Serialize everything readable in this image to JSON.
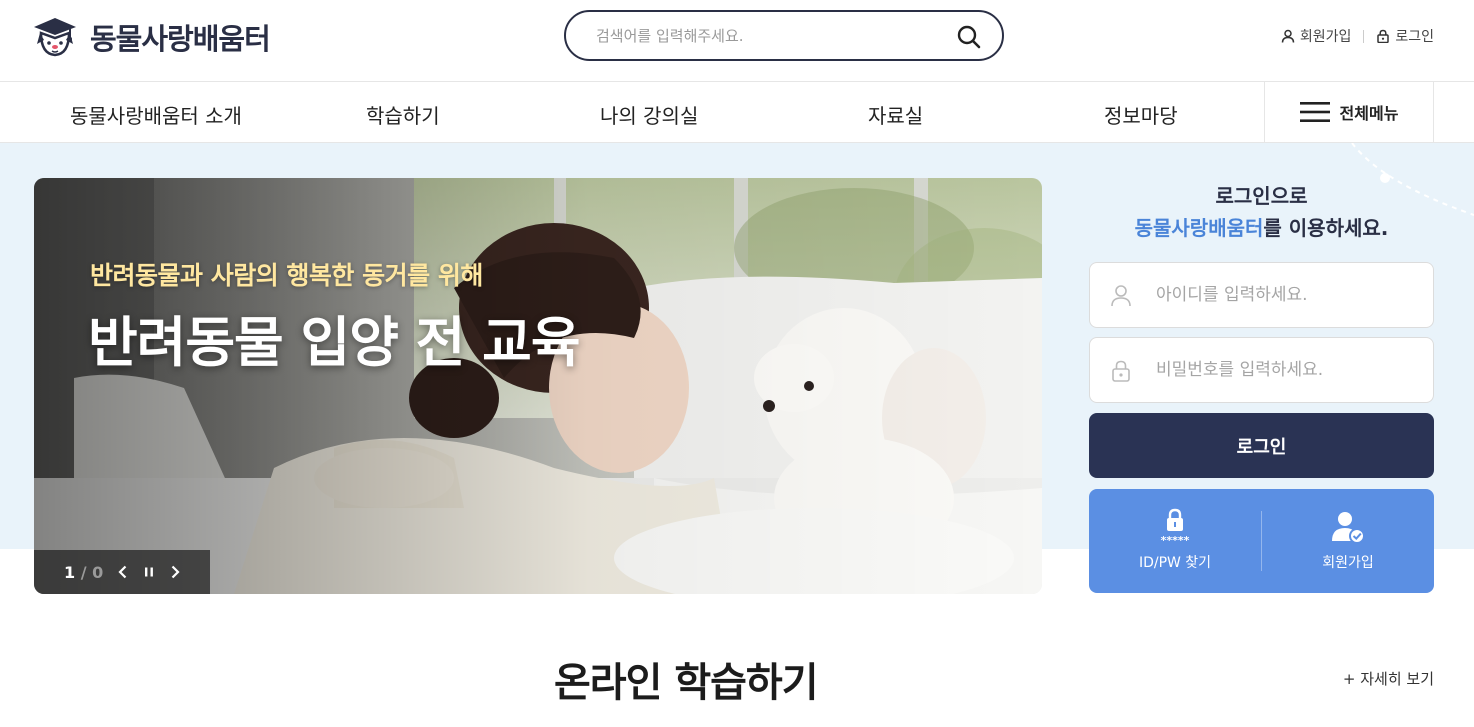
{
  "header": {
    "site_name": "동물사랑배움터",
    "search_placeholder": "검색어를 입력해주세요.",
    "util": {
      "join_label": "회원가입",
      "login_label": "로그인"
    }
  },
  "nav": {
    "items": [
      {
        "label": "동물사랑배움터 소개"
      },
      {
        "label": "학습하기"
      },
      {
        "label": "나의 강의실"
      },
      {
        "label": "자료실"
      },
      {
        "label": "정보마당"
      }
    ],
    "all_menu_label": "전체메뉴"
  },
  "banner": {
    "subtitle": "반려동물과 사람의 행복한 동거를 위해",
    "title": "반려동물 입양 전 교육",
    "counter_current": "1",
    "counter_sep": "/",
    "counter_total": "0"
  },
  "login": {
    "heading_line1": "로그인으로",
    "heading_highlight": "동물사랑배움터",
    "heading_rest": "를 이용하세요.",
    "id_placeholder": "아이디를 입력하세요.",
    "pw_placeholder": "비밀번호를 입력하세요.",
    "login_button": "로그인",
    "find_label": "ID/PW 찾기",
    "find_icon_caption": "*****",
    "join_label": "회원가입"
  },
  "section": {
    "title": "온라인 학습하기",
    "more_label": "+  자세히 보기"
  },
  "colors": {
    "navy": "#2a3354",
    "accent_blue": "#5b8fe3",
    "highlight_blue": "#4a84d8",
    "banner_subtitle": "#ffe7a0",
    "band_bg": "#e9f3fa"
  },
  "icons": {
    "logo": "dog-graduation-cap-icon",
    "search": "search-icon",
    "join": "user-icon",
    "login": "lock-icon",
    "all_menu": "hamburger-icon",
    "prev": "chevron-left-icon",
    "pause": "pause-icon",
    "next": "chevron-right-icon",
    "id_field": "user-icon",
    "pw_field": "lock-icon",
    "find": "lock-password-icon",
    "member": "user-check-icon"
  }
}
